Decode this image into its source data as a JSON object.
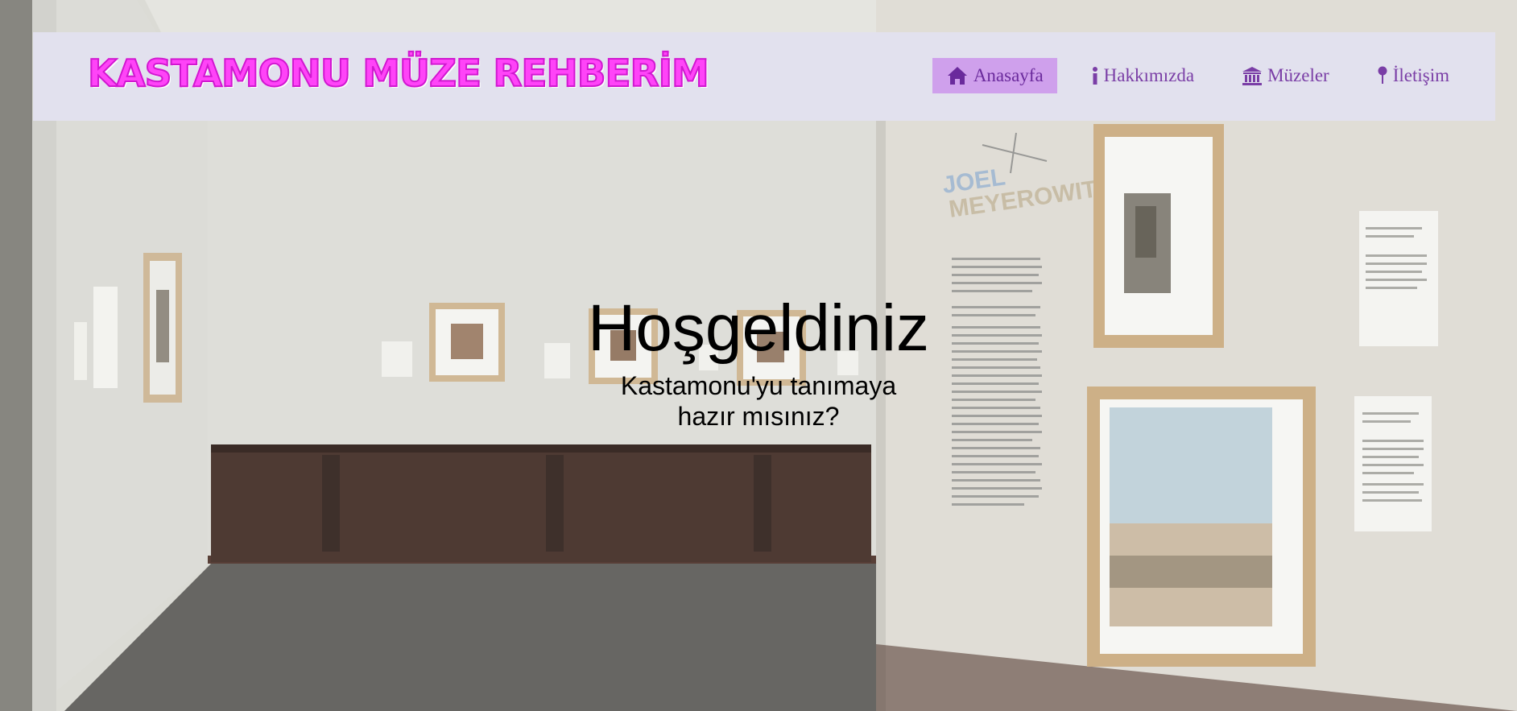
{
  "brand": {
    "title": "KASTAMONU MÜZE REHBERİM"
  },
  "nav": {
    "items": [
      {
        "label": "Anasayfa",
        "icon": "home-icon",
        "active": true
      },
      {
        "label": "Hakkımızda",
        "icon": "info-icon",
        "active": false
      },
      {
        "label": "Müzeler",
        "icon": "museum-icon",
        "active": false
      },
      {
        "label": "İletişim",
        "icon": "map-pin-icon",
        "active": false
      }
    ]
  },
  "hero": {
    "title": "Hoşgeldiniz",
    "subtitle": "Kastamonu'yu tanımaya hazır mısınız?"
  },
  "wall_text": {
    "name_line1": "JOEL",
    "name_line2": "MEYEROWITZ"
  },
  "colors": {
    "navbar_bg": "#e2e1ee",
    "brand": "#ff44f8",
    "nav_text": "#7a3ea6",
    "nav_active_bg": "#cfa0ec"
  }
}
